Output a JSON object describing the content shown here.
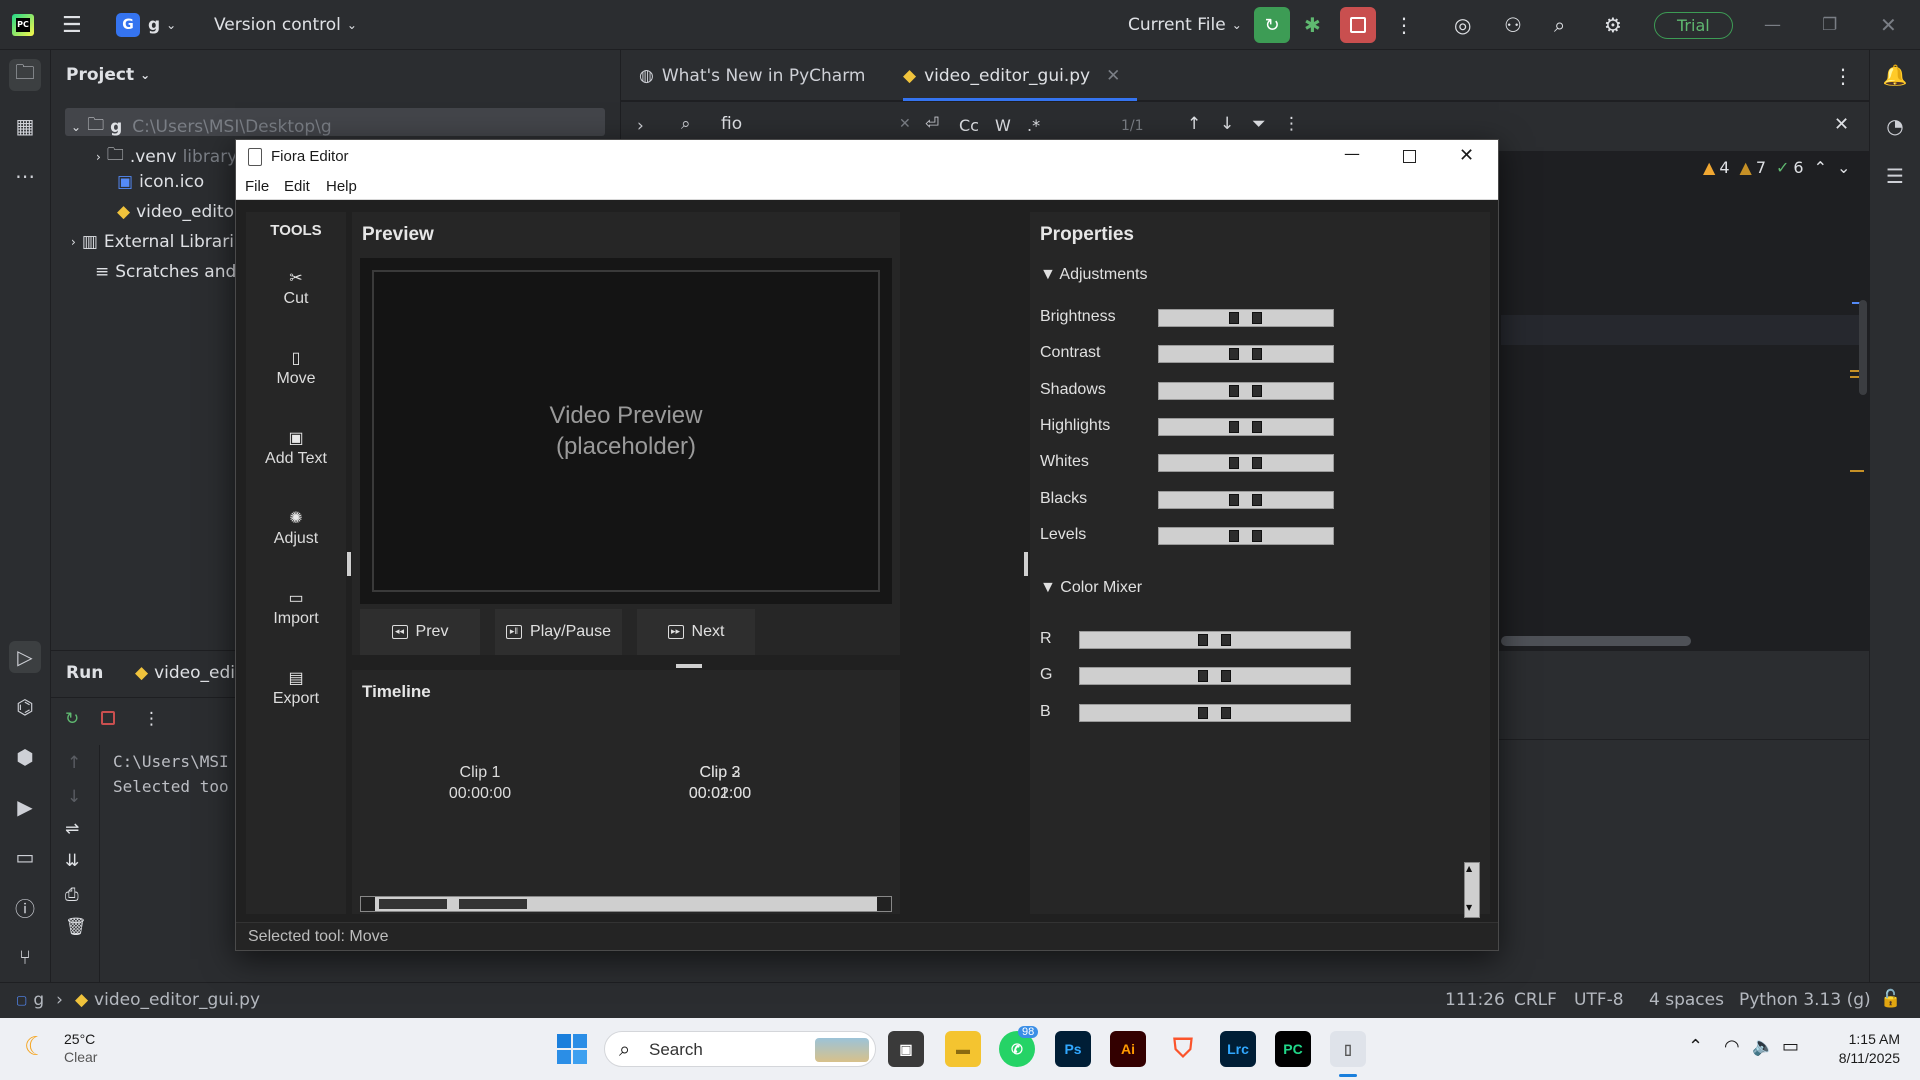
{
  "ide": {
    "project_badge": "G",
    "project_name": "g",
    "vcs": "Version control",
    "run_config": "Current File",
    "trial": "Trial",
    "project_panel_title": "Project",
    "tree": {
      "root_name": "g",
      "root_path": "C:\\Users\\MSI\\Desktop\\g",
      "venv": ".venv",
      "venv_hint": "library",
      "icon_file": "icon.ico",
      "script_file": "video_editor",
      "external": "External Librari",
      "scratches": "Scratches and C"
    },
    "tabs": [
      {
        "label": "What's New in PyCharm"
      },
      {
        "label": "video_editor_gui.py"
      }
    ],
    "find": {
      "query": "fio",
      "count": "1/1",
      "cc": "Cc",
      "w": "W",
      "regex": ".*"
    },
    "inspections": {
      "warn_a": "4",
      "warn_b": "7",
      "ok": "6"
    },
    "run": {
      "title": "Run",
      "tab": "video_edit",
      "line1": "C:\\Users\\MSI",
      "line2": "Selected too"
    },
    "status": {
      "crumb_project": "g",
      "crumb_file": "video_editor_gui.py",
      "position": "111:26",
      "line_sep": "CRLF",
      "encoding": "UTF-8",
      "indent": "4 spaces",
      "interpreter": "Python 3.13 (g)"
    }
  },
  "fiora": {
    "title": "Fiora Editor",
    "menu": [
      "File",
      "Edit",
      "Help"
    ],
    "tools_title": "TOOLS",
    "tools": [
      {
        "glyph": "✂",
        "label": "Cut"
      },
      {
        "glyph": "▯",
        "label": "Move"
      },
      {
        "glyph": "▣",
        "label": "Add Text"
      },
      {
        "glyph": "✺",
        "label": "Adjust"
      },
      {
        "glyph": "▭",
        "label": "Import"
      },
      {
        "glyph": "▤",
        "label": "Export"
      }
    ],
    "preview_title": "Preview",
    "preview_line1": "Video Preview",
    "preview_line2": "(placeholder)",
    "buttons": {
      "prev": "Prev",
      "play": "Play/Pause",
      "next": "Next"
    },
    "timeline_title": "Timeline",
    "clips": [
      {
        "name": "Clip 1",
        "time": "00:00:00"
      },
      {
        "name": "Clip 2",
        "time": "00:01:00"
      },
      {
        "name": "Clip 3",
        "time": "00:02:00"
      }
    ],
    "properties_title": "Properties",
    "adjustments_title": "▼ Adjustments",
    "adjustments": [
      "Brightness",
      "Contrast",
      "Shadows",
      "Highlights",
      "Whites",
      "Blacks",
      "Levels"
    ],
    "mixer_title": "▼ Color Mixer",
    "mixer": [
      "R",
      "G",
      "B"
    ],
    "status": "Selected tool: Move"
  },
  "taskbar": {
    "temp": "25°C",
    "weather": "Clear",
    "search": "Search",
    "whatsapp_badge": "98",
    "time": "1:15 AM",
    "date": "8/11/2025"
  },
  "colors": {
    "accent_green": "#3d9c55",
    "stop_red": "#c94f4f",
    "ide_bg": "#2b2d30"
  }
}
